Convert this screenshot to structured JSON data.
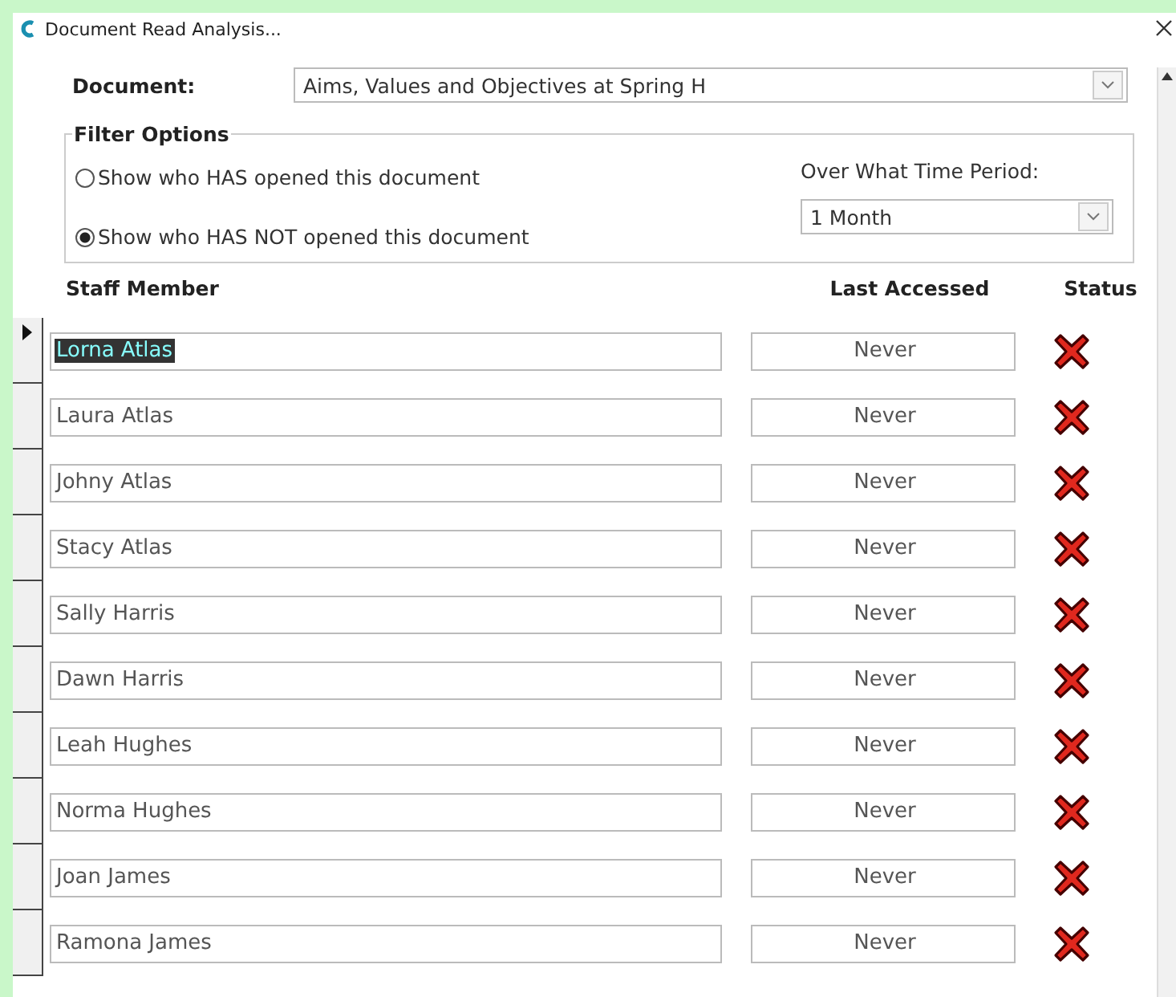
{
  "window": {
    "title": "Document Read Analysis..."
  },
  "document": {
    "label": "Document:",
    "value": "Aims, Values and Objectives at Spring H"
  },
  "filter": {
    "title": "Filter Options",
    "options": [
      {
        "label": "Show who HAS opened this document",
        "selected": false
      },
      {
        "label": "Show who HAS NOT opened this document",
        "selected": true
      }
    ],
    "period_label": "Over What Time Period:",
    "period_value": "1 Month"
  },
  "table": {
    "columns": [
      "Staff Member",
      "Last Accessed",
      "Status"
    ],
    "rows": [
      {
        "name": "Lorna Atlas",
        "last_accessed": "Never",
        "opened": false,
        "selected": true
      },
      {
        "name": "Laura Atlas",
        "last_accessed": "Never",
        "opened": false,
        "selected": false
      },
      {
        "name": "Johny Atlas",
        "last_accessed": "Never",
        "opened": false,
        "selected": false
      },
      {
        "name": "Stacy Atlas",
        "last_accessed": "Never",
        "opened": false,
        "selected": false
      },
      {
        "name": "Sally Harris",
        "last_accessed": "Never",
        "opened": false,
        "selected": false
      },
      {
        "name": "Dawn Harris",
        "last_accessed": "Never",
        "opened": false,
        "selected": false
      },
      {
        "name": "Leah Hughes",
        "last_accessed": "Never",
        "opened": false,
        "selected": false
      },
      {
        "name": "Norma Hughes",
        "last_accessed": "Never",
        "opened": false,
        "selected": false
      },
      {
        "name": "Joan James",
        "last_accessed": "Never",
        "opened": false,
        "selected": false
      },
      {
        "name": "Ramona James",
        "last_accessed": "Never",
        "opened": false,
        "selected": false
      }
    ]
  }
}
